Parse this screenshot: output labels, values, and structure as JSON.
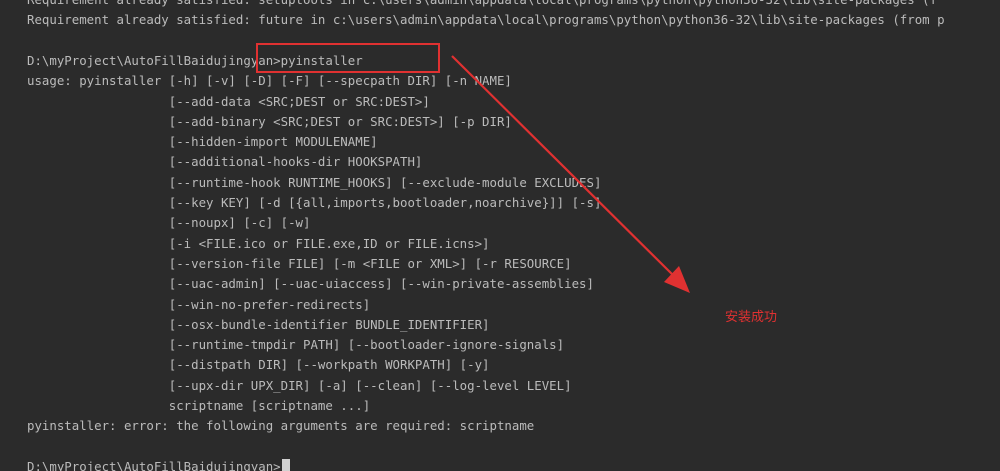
{
  "terminal": {
    "lines": [
      "Requirement already satisfied: setuptools in c:\\users\\admin\\appdata\\local\\programs\\python\\python36-32\\lib\\site-packages (f",
      "Requirement already satisfied: future in c:\\users\\admin\\appdata\\local\\programs\\python\\python36-32\\lib\\site-packages (from p",
      "",
      "D:\\myProject\\AutoFillBaidujingyan>pyinstaller",
      "usage: pyinstaller [-h] [-v] [-D] [-F] [--specpath DIR] [-n NAME]",
      "                   [--add-data <SRC;DEST or SRC:DEST>]",
      "                   [--add-binary <SRC;DEST or SRC:DEST>] [-p DIR]",
      "                   [--hidden-import MODULENAME]",
      "                   [--additional-hooks-dir HOOKSPATH]",
      "                   [--runtime-hook RUNTIME_HOOKS] [--exclude-module EXCLUDES]",
      "                   [--key KEY] [-d [{all,imports,bootloader,noarchive}]] [-s]",
      "                   [--noupx] [-c] [-w]",
      "                   [-i <FILE.ico or FILE.exe,ID or FILE.icns>]",
      "                   [--version-file FILE] [-m <FILE or XML>] [-r RESOURCE]",
      "                   [--uac-admin] [--uac-uiaccess] [--win-private-assemblies]",
      "                   [--win-no-prefer-redirects]",
      "                   [--osx-bundle-identifier BUNDLE_IDENTIFIER]",
      "                   [--runtime-tmpdir PATH] [--bootloader-ignore-signals]",
      "                   [--distpath DIR] [--workpath WORKPATH] [-y]",
      "                   [--upx-dir UPX_DIR] [-a] [--clean] [--log-level LEVEL]",
      "                   scriptname [scriptname ...]",
      "pyinstaller: error: the following arguments are required: scriptname",
      "",
      "D:\\myProject\\AutoFillBaidujingyan>"
    ]
  },
  "annotation": {
    "text": "安装成功"
  },
  "colors": {
    "background": "#2b2b2b",
    "text": "#bbbbbb",
    "annotation": "#e03131"
  }
}
